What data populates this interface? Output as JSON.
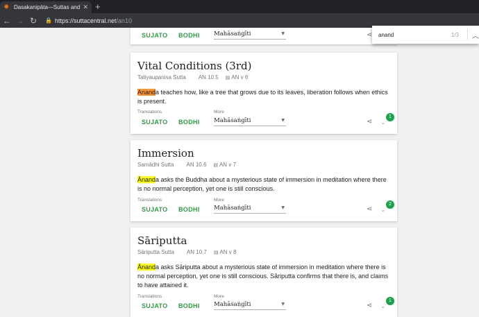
{
  "browser": {
    "tab_title": "Dasakanipāta—Suttas and Parall",
    "tab_close": "✕",
    "new_tab": "+",
    "url_host": "https://suttacentral.net",
    "url_path": "/an10"
  },
  "find": {
    "query": "anand",
    "count": "1/3",
    "up": "︿"
  },
  "common": {
    "translations_label": "Translations",
    "more_label": "More",
    "sujato": "SUJATO",
    "bodhi": "BODHI",
    "select_value": "Mahāsaṅgīti"
  },
  "cards": [
    {
      "title": "Vital Conditions (3rd)",
      "pali": "Tatiyaupanisa Sutta",
      "num": "AN 10.5",
      "vol": "AN v 6",
      "hl": "Anand",
      "blurb": "a teaches how, like a tree that grows due to its leaves, liberation follows when ethics is present.",
      "badge": "1"
    },
    {
      "title": "Immersion",
      "pali": "Samādhi Sutta",
      "num": "AN 10.6",
      "vol": "AN v 7",
      "hl": "Ānand",
      "blurb": "a asks the Buddha about a mysterious state of immersion in meditation where there is no normal perception, yet one is still conscious.",
      "badge": "2"
    },
    {
      "title": "Sāriputta",
      "pali": "Sāriputta Sutta",
      "num": "AN 10.7",
      "vol": "AN v 8",
      "hl": "Ānand",
      "blurb": "a asks Sāriputta about a mysterious state of immersion in meditation where there is no normal perception, yet one is still conscious. Sāriputta confirms that there is, and claims to have attained it.",
      "badge": "1"
    }
  ]
}
